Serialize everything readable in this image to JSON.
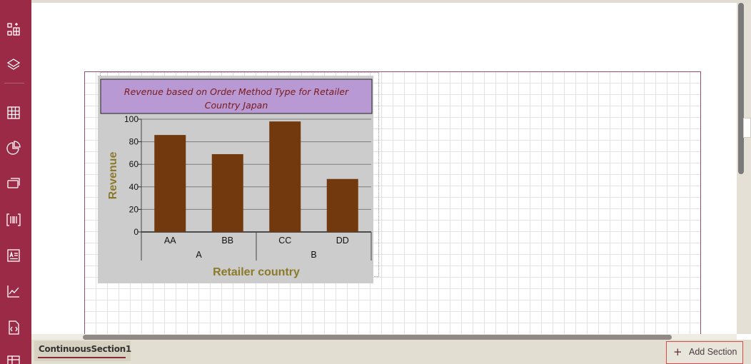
{
  "sidebar": {
    "items": [
      {
        "icon": "widget-add-icon"
      },
      {
        "icon": "layers-icon"
      },
      {
        "icon": "table-grid-icon"
      },
      {
        "icon": "pie-chart-icon"
      },
      {
        "icon": "subreport-icon"
      },
      {
        "icon": "barcode-icon"
      },
      {
        "icon": "textbox-icon"
      },
      {
        "icon": "line-chart-icon"
      },
      {
        "icon": "document-embed-icon"
      },
      {
        "icon": "table-icon"
      }
    ],
    "color": "#9a2a45"
  },
  "chart_data": {
    "type": "bar",
    "title": "Revenue based on Order Method Type for Retailer Country Japan",
    "xlabel": "Retailer country",
    "ylabel": "Revenue",
    "ylim": [
      0,
      100
    ],
    "yticks": [
      "100",
      "80",
      "60",
      "40",
      "20",
      "0"
    ],
    "categories": [
      "AA",
      "BB",
      "CC",
      "DD"
    ],
    "groups": [
      {
        "label": "A",
        "categories": [
          "AA",
          "BB"
        ]
      },
      {
        "label": "B",
        "categories": [
          "CC",
          "DD"
        ]
      }
    ],
    "values": [
      86,
      69,
      98,
      47
    ],
    "grid": true,
    "bar_color": "#72390f",
    "title_bg": "#b899d4",
    "title_color": "#7a1a1a",
    "axis_label_color": "#8b7a2a",
    "plot_bg": "#cccccc"
  },
  "footer": {
    "tab_label": "ContinuousSection1",
    "add_section_label": "Add Section"
  }
}
